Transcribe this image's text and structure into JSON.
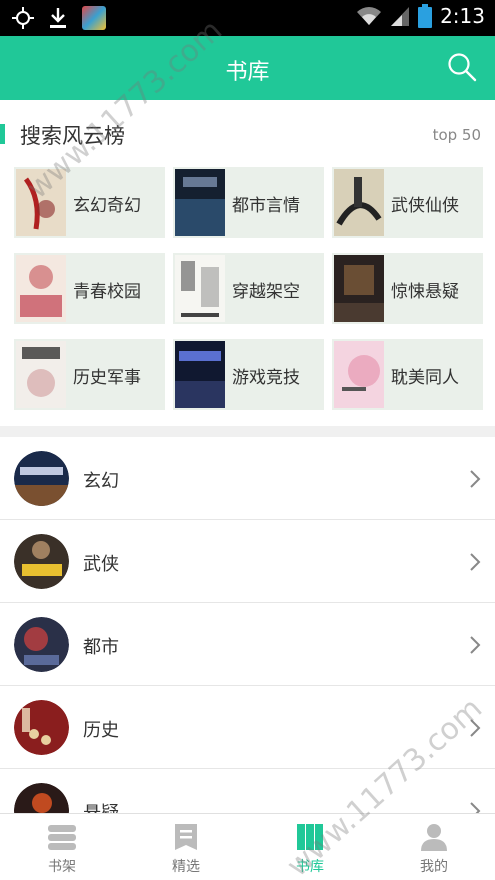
{
  "status_bar": {
    "time": "2:13"
  },
  "header": {
    "title": "书库"
  },
  "rank": {
    "title": "搜索风云榜",
    "top_label": "top 50",
    "items": [
      {
        "label": "玄幻奇幻"
      },
      {
        "label": "都市言情"
      },
      {
        "label": "武侠仙侠"
      },
      {
        "label": "青春校园"
      },
      {
        "label": "穿越架空"
      },
      {
        "label": "惊悚悬疑"
      },
      {
        "label": "历史军事"
      },
      {
        "label": "游戏竞技"
      },
      {
        "label": "耽美同人"
      }
    ]
  },
  "categories": [
    {
      "label": "玄幻"
    },
    {
      "label": "武侠"
    },
    {
      "label": "都市"
    },
    {
      "label": "历史"
    },
    {
      "label": "悬疑"
    }
  ],
  "tabs": [
    {
      "label": "书架",
      "icon": "bookshelf-icon"
    },
    {
      "label": "精选",
      "icon": "featured-icon"
    },
    {
      "label": "书库",
      "icon": "library-icon",
      "active": true
    },
    {
      "label": "我的",
      "icon": "profile-icon"
    }
  ],
  "colors": {
    "accent": "#20c898",
    "header_bg": "#20c898",
    "cell_bg": "#eaf0ea"
  },
  "watermarks": [
    "www.11773.com",
    "www.11773.com"
  ]
}
